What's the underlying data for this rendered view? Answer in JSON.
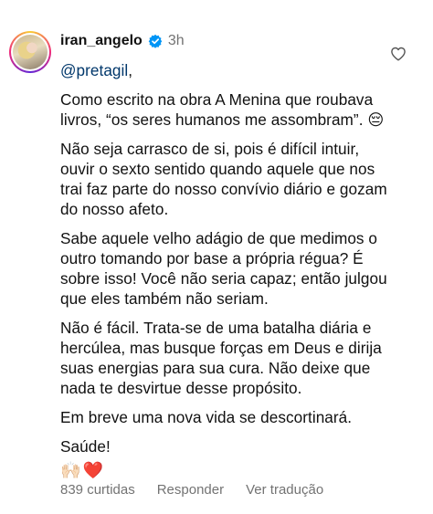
{
  "comment": {
    "username": "iran_angelo",
    "verified_icon": "verified-badge-icon",
    "time": "3h",
    "like_icon": "heart-outline-icon",
    "mention_text": "@pretagil",
    "mention_suffix": ",",
    "paragraphs": [
      "Como escrito na obra A Menina que roubava livros, “os seres humanos me assombram”. 😔",
      "Não seja carrasco de si, pois é difícil intuir, ouvir o sexto sentido quando aquele que nos trai faz parte do nosso convívio diário e gozam do nosso afeto.",
      "Sabe aquele velho adágio de que medimos o outro tomando por base a própria régua? É sobre isso! Você não seria capaz; então julgou que eles também não seriam.",
      "Não é fácil. Trata-se de uma batalha diária e hercúlea, mas busque forças em Deus e dirija suas energias para sua cura. Não deixe que nada te desvirtue desse propósito.",
      "Em breve uma nova vida se descortinará.",
      "Saúde!"
    ],
    "emojis": [
      "🙌🏻",
      "❤️"
    ]
  },
  "footer": {
    "likes": "839 curtidas",
    "reply": "Responder",
    "translate": "Ver tradução"
  },
  "colors": {
    "verified": "#0095f6",
    "mention": "#00376b",
    "secondary_text": "#737373"
  }
}
